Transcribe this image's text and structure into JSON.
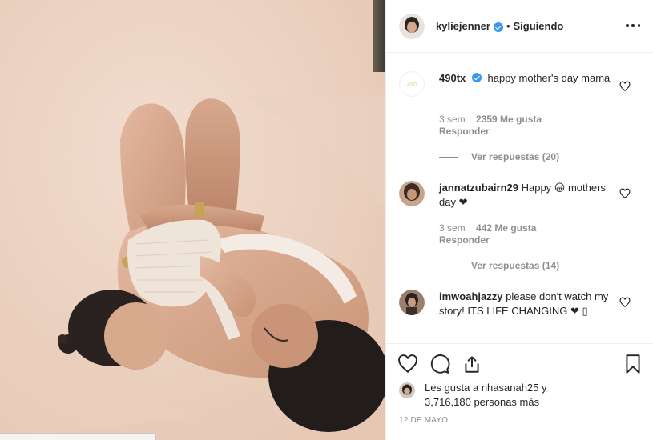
{
  "post": {
    "author": "kyliejenner",
    "follow_status": "Siguiendo",
    "separator": "•",
    "date": "12 DE MAYO"
  },
  "comments": [
    {
      "user": "490tx",
      "verified": true,
      "text": "happy mother's day mama",
      "age": "3 sem",
      "likes": "2359 Me gusta",
      "reply_label": "Responder",
      "replies_label": "Ver respuestas (20)"
    },
    {
      "user": "jannatzubairn29",
      "verified": false,
      "text": "Happy 😀 mothers day ❤",
      "age": "3 sem",
      "likes": "442 Me gusta",
      "reply_label": "Responder",
      "replies_label": "Ver respuestas (14)"
    },
    {
      "user": "imwoahjazzy",
      "verified": false,
      "text": "please don't watch my story! ITS LIFE CHANGING ❤ ▯"
    }
  ],
  "likes_summary": {
    "line1": "Les gusta a nhasanah25 y",
    "line2": "3,716,180 personas más"
  },
  "icons": {
    "more": "more-options-icon",
    "comment_like": "heart-outline-icon",
    "like": "heart-outline-icon",
    "comment": "comment-bubble-icon",
    "share": "share-icon",
    "save": "bookmark-icon",
    "verified": "verified-badge-icon"
  },
  "colors": {
    "verified": "#3897f0",
    "muted_text": "#8e8e8e",
    "heart_emoji": "#ed4956"
  }
}
